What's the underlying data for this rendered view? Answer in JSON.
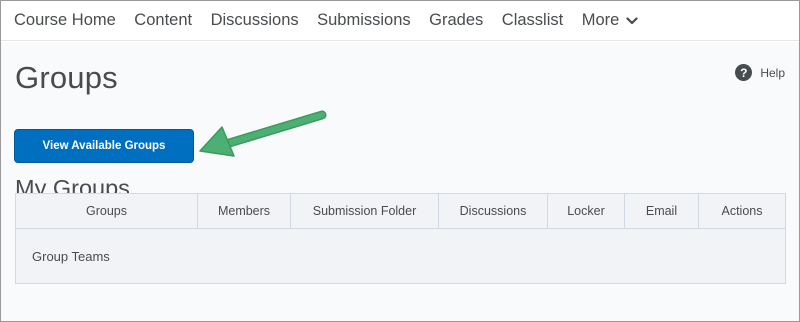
{
  "nav": {
    "items": [
      {
        "label": "Course Home"
      },
      {
        "label": "Content"
      },
      {
        "label": "Discussions"
      },
      {
        "label": "Submissions"
      },
      {
        "label": "Grades"
      },
      {
        "label": "Classlist"
      }
    ],
    "more_label": "More"
  },
  "page": {
    "title": "Groups",
    "help_label": "Help",
    "help_icon_glyph": "?",
    "view_groups_button": "View Available Groups",
    "section_title": "My Groups"
  },
  "table": {
    "columns": [
      "Groups",
      "Members",
      "Submission Folder",
      "Discussions",
      "Locker",
      "Email",
      "Actions"
    ],
    "rows": [
      {
        "group": "Group Teams"
      }
    ]
  },
  "colors": {
    "primary_button": "#006fbf",
    "annotation_arrow": "#4caf74",
    "text": "#494c4e"
  }
}
